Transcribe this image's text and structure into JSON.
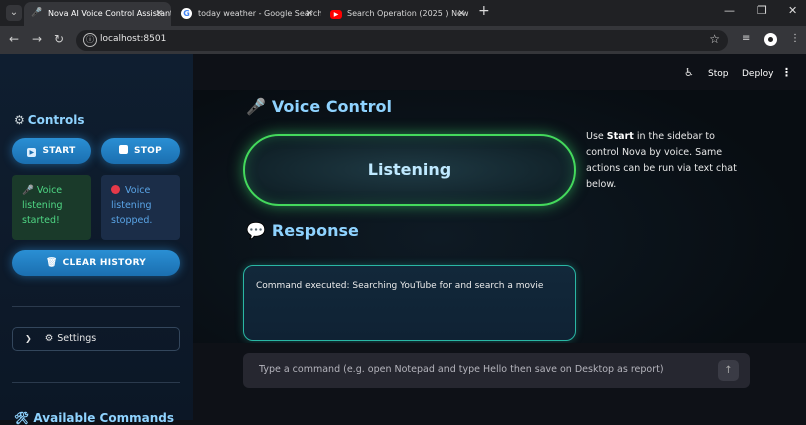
{
  "browser": {
    "tabs": [
      {
        "title": "Nova AI Voice Control Assistant",
        "icon": "microphone-icon",
        "active": true
      },
      {
        "title": "today weather - Google Search",
        "icon": "google-icon",
        "active": false
      },
      {
        "title": "Search Operation (2025 ) New",
        "icon": "youtube-icon",
        "active": false
      }
    ],
    "url": "localhost:8501"
  },
  "toolbar": {
    "stop_label": "Stop",
    "deploy_label": "Deploy"
  },
  "sidebar": {
    "title": "Controls",
    "start_label": "START",
    "stop_label": "STOP",
    "alert_started": "Voice listening started!",
    "alert_stopped": "Voice listening stopped.",
    "clear_label": "CLEAR HISTORY",
    "settings_label": "Settings",
    "bottom_heading": "Available Commands"
  },
  "main": {
    "voice_heading": "Voice Control",
    "listening_status": "Listening",
    "hint_prefix": "Use ",
    "hint_bold": "Start",
    "hint_suffix": " in the sidebar to control Nova by voice. Same actions can be run via text chat below.",
    "response_heading": "Response",
    "response_text": "Command executed: Searching YouTube for and search a movie",
    "chat_placeholder": "Type a command (e.g. open Notepad and type Hello then save on Desktop as report)"
  },
  "colors": {
    "accent": "#8fd3ff",
    "success": "#44d95c",
    "button": "#2a8fd4",
    "response_border": "#2ab7a4"
  }
}
